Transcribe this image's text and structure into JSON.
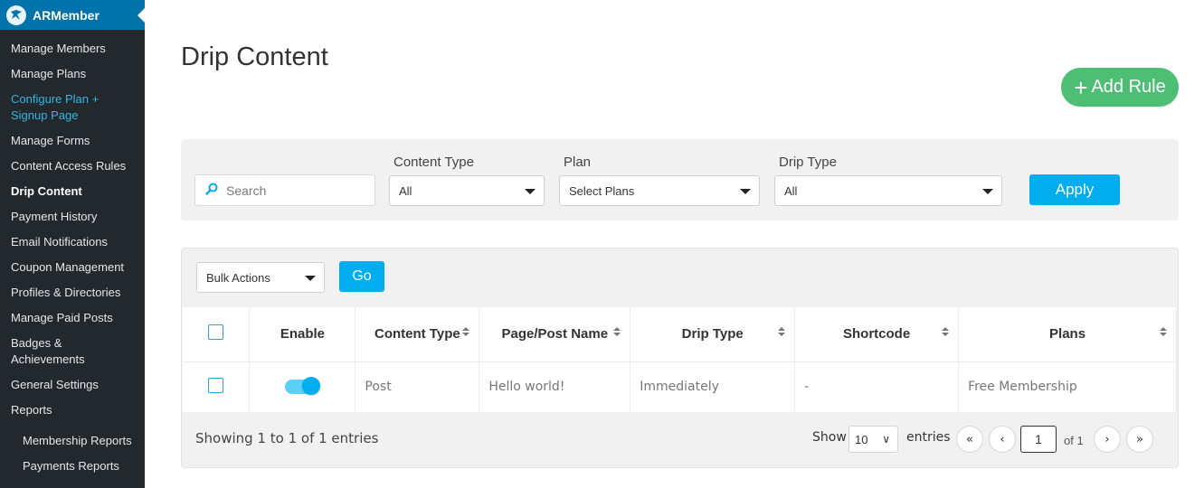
{
  "sidebar": {
    "brand": "ARMember",
    "items": [
      {
        "label": "Manage Members"
      },
      {
        "label": "Manage Plans"
      },
      {
        "label": "Configure Plan +"
      },
      {
        "label": "Signup Page"
      },
      {
        "label": "Manage Forms"
      },
      {
        "label": "Content Access Rules"
      },
      {
        "label": "Drip Content"
      },
      {
        "label": "Payment History"
      },
      {
        "label": "Email Notifications"
      },
      {
        "label": "Coupon Management"
      },
      {
        "label": "Profiles & Directories"
      },
      {
        "label": "Manage Paid Posts"
      },
      {
        "label": "Badges &"
      },
      {
        "label": "Achievements"
      },
      {
        "label": "General Settings"
      },
      {
        "label": "Reports"
      },
      {
        "label": "Membership Reports"
      },
      {
        "label": "Payments Reports"
      }
    ]
  },
  "page": {
    "title": "Drip Content",
    "add_rule_label": "Add Rule"
  },
  "filters": {
    "search_placeholder": "Search",
    "content_type_label": "Content Type",
    "content_type_value": "All",
    "plan_label": "Plan",
    "plan_value": "Select Plans",
    "drip_type_label": "Drip Type",
    "drip_type_value": "All",
    "apply_label": "Apply"
  },
  "table": {
    "bulk_actions": "Bulk Actions",
    "go_label": "Go",
    "headers": {
      "enable": "Enable",
      "content_type": "Content Type",
      "page_post_name": "Page/Post Name",
      "drip_type": "Drip Type",
      "shortcode": "Shortcode",
      "plans": "Plans"
    },
    "rows": [
      {
        "enabled": true,
        "content_type": "Post",
        "page_post_name": "Hello world!",
        "drip_type": "Immediately",
        "shortcode": "-",
        "plans": "Free Membership"
      }
    ],
    "showing_text": "Showing 1 to 1 of 1 entries",
    "show_label": "Show",
    "entries_value": "10",
    "entries_label": "entries",
    "page_number": "1",
    "of_text": "of 1"
  },
  "colors": {
    "sidebar_bg": "#23282d",
    "brand_bg": "#0073aa",
    "accent": "#00aeef",
    "add_rule_green": "#4dbe74",
    "highlight_link": "#33b5e5"
  }
}
